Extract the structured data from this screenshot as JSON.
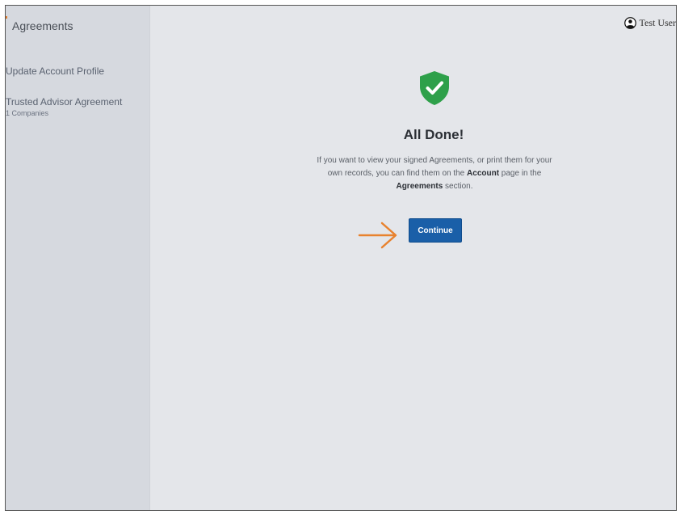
{
  "sidebar": {
    "title": "Agreements",
    "items": [
      {
        "label": "Update Account Profile"
      },
      {
        "label": "Trusted Advisor Agreement",
        "sub": "1 Companies"
      }
    ]
  },
  "header": {
    "user_name": "Test User",
    "user_icon": "user-circle-icon"
  },
  "main": {
    "status_icon": "shield-check-icon",
    "title": "All Done!",
    "message": {
      "line1": "If you want to view your signed Agreements, or print them for your",
      "line2_before": "own records, you can find them on the ",
      "line2_bold": "Account",
      "line2_after": " page in the",
      "line3_bold": "Agreements",
      "line3_after": " section."
    },
    "continue_label": "Continue",
    "annotation": "arrow-right-icon"
  },
  "colors": {
    "primary_button": "#1a5fa8",
    "success_shield": "#2ea04a",
    "annotation_arrow": "#e8822e",
    "sidebar_bg": "#d6d9df",
    "main_bg": "#e4e6ea"
  }
}
